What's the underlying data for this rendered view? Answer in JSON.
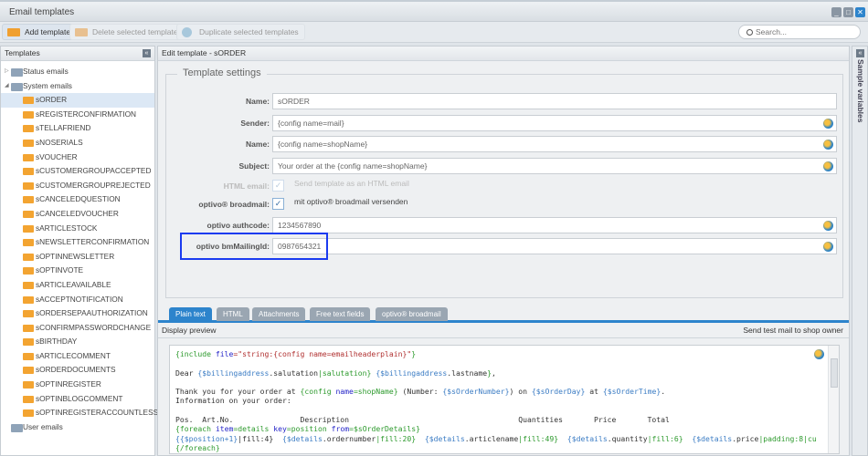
{
  "window": {
    "title": "Email templates",
    "minimize": "_",
    "maximize": "□",
    "close": "✕"
  },
  "toolbar": {
    "add": "Add template",
    "delete": "Delete selected templates",
    "duplicate": "Duplicate selected templates",
    "search_placeholder": "Search..."
  },
  "left": {
    "title": "Templates",
    "collapse": "«",
    "folders": {
      "status": "Status emails",
      "system": "System emails",
      "user": "User emails"
    },
    "items": [
      "sORDER",
      "sREGISTERCONFIRMATION",
      "sTELLAFRIEND",
      "sNOSERIALS",
      "sVOUCHER",
      "sCUSTOMERGROUPACCEPTED",
      "sCUSTOMERGROUPREJECTED",
      "sCANCELEDQUESTION",
      "sCANCELEDVOUCHER",
      "sARTICLESTOCK",
      "sNEWSLETTERCONFIRMATION",
      "sOPTINNEWSLETTER",
      "sOPTINVOTE",
      "sARTICLEAVAILABLE",
      "sACCEPTNOTIFICATION",
      "sORDERSEPAAUTHORIZATION",
      "sCONFIRMPASSWORDCHANGE",
      "sBIRTHDAY",
      "sARTICLECOMMENT",
      "sORDERDOCUMENTS",
      "sOPTINREGISTER",
      "sOPTINBLOGCOMMENT",
      "sOPTINREGISTERACCOUNTLESS"
    ],
    "selected": "sORDER"
  },
  "main": {
    "title": "Edit template - sORDER",
    "legend": "Template settings",
    "fields": {
      "name_label": "Name:",
      "name": "sORDER",
      "sender_label": "Sender:",
      "sender": "{config name=mail}",
      "fromname_label": "Name:",
      "fromname": "{config name=shopName}",
      "subject_label": "Subject:",
      "subject": "Your order at the {config name=shopName}",
      "html_label": "HTML email:",
      "html_text": "Send template as an HTML email",
      "html_checked": true,
      "broadmail_label": "optivo® broadmail:",
      "broadmail_text": "mit optivo® broadmail versenden",
      "broadmail_checked": true,
      "authcode_label": "optivo authcode:",
      "authcode": "1234567890",
      "mailingid_label": "optivo bmMailingId:",
      "mailingid": "0987654321"
    },
    "tabs": [
      "Plain text",
      "HTML",
      "Attachments",
      "Free text fields",
      "optivo® broadmail"
    ],
    "active_tab": "Plain text",
    "preview": "Display preview",
    "send_test": "Send test mail to shop owner",
    "code": [
      [
        [
          "{include ",
          "g"
        ],
        [
          "file",
          "b"
        ],
        [
          "=\"string:{config name=emailheaderplain}\"",
          "r"
        ],
        [
          "}",
          "g"
        ]
      ],
      [],
      [
        [
          "Dear ",
          "t"
        ],
        [
          "{$billingaddress",
          "v"
        ],
        [
          ".salutation",
          "t"
        ],
        [
          "|salutation}",
          "g"
        ],
        [
          " ",
          "t"
        ],
        [
          "{$billingaddress",
          "v"
        ],
        [
          ".lastname",
          "t"
        ],
        [
          "}",
          "g"
        ],
        [
          ",",
          "t"
        ]
      ],
      [],
      [
        [
          "Thank you for your order at ",
          "t"
        ],
        [
          "{config ",
          "g"
        ],
        [
          "name",
          "b"
        ],
        [
          "=shopName}",
          "g"
        ],
        [
          " (Number: ",
          "t"
        ],
        [
          "{$sOrderNumber}",
          "v"
        ],
        [
          ") on ",
          "t"
        ],
        [
          "{$sOrderDay}",
          "v"
        ],
        [
          " at ",
          "t"
        ],
        [
          "{$sOrderTime}",
          "v"
        ],
        [
          ".",
          "t"
        ]
      ],
      [
        [
          "Information on your order:",
          "t"
        ]
      ],
      [],
      [
        [
          "Pos.  Art.No.               Description                                      Quantities       Price       Total",
          "t"
        ]
      ],
      [
        [
          "{foreach ",
          "g"
        ],
        [
          "item",
          "b"
        ],
        [
          "=details ",
          "g"
        ],
        [
          "key",
          "b"
        ],
        [
          "=position ",
          "g"
        ],
        [
          "from",
          "b"
        ],
        [
          "=$sOrderDetails}",
          "g"
        ]
      ],
      [
        [
          "{{$position+1}",
          "v"
        ],
        [
          "|fill:4}",
          "t"
        ],
        [
          "  ",
          "t"
        ],
        [
          "{$details",
          "v"
        ],
        [
          ".ordernumber",
          "t"
        ],
        [
          "|fill:20}",
          "g"
        ],
        [
          "  ",
          "t"
        ],
        [
          "{$details",
          "v"
        ],
        [
          ".articlename",
          "t"
        ],
        [
          "|fill:49}",
          "g"
        ],
        [
          "  ",
          "t"
        ],
        [
          "{$details",
          "v"
        ],
        [
          ".quantity",
          "t"
        ],
        [
          "|fill:6}",
          "g"
        ],
        [
          "  ",
          "t"
        ],
        [
          "{$details",
          "v"
        ],
        [
          ".price",
          "t"
        ],
        [
          "|padding:8|cu",
          "g"
        ]
      ],
      [
        [
          "{/foreach}",
          "g"
        ]
      ]
    ]
  },
  "right": {
    "title": "Sample variables",
    "collapse": "«"
  }
}
